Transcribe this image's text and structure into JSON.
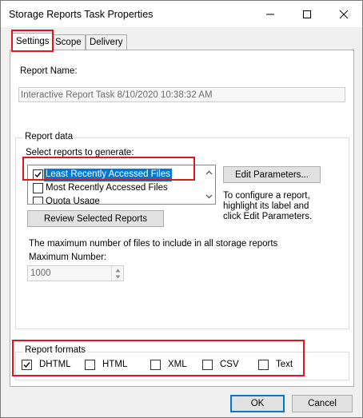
{
  "window": {
    "title": "Storage Reports Task Properties"
  },
  "tabs": [
    {
      "label": "Settings"
    },
    {
      "label": "Scope"
    },
    {
      "label": "Delivery"
    }
  ],
  "report_name": {
    "label": "Report Name:",
    "value": "Interactive Report Task 8/10/2020 10:38:32 AM"
  },
  "report_data": {
    "group_title": "Report data",
    "select_label": "Select reports to generate:",
    "items": [
      {
        "label": "Least Recently Accessed Files",
        "checked": true
      },
      {
        "label": "Most Recently Accessed Files",
        "checked": false
      },
      {
        "label": "Quota Usage",
        "checked": false
      }
    ],
    "edit_button": "Edit Parameters...",
    "help_lines": [
      "To configure a report,",
      "highlight its label and",
      "click Edit Parameters."
    ],
    "review_button": "Review Selected Reports",
    "max_desc": "The maximum number of files to include in all storage reports",
    "max_label": "Maximum Number:",
    "max_value": "1000"
  },
  "report_formats": {
    "group_title": "Report formats",
    "options": [
      {
        "label": "DHTML",
        "checked": true
      },
      {
        "label": "HTML",
        "checked": false
      },
      {
        "label": "XML",
        "checked": false
      },
      {
        "label": "CSV",
        "checked": false
      },
      {
        "label": "Text",
        "checked": false
      }
    ]
  },
  "footer": {
    "ok": "OK",
    "cancel": "Cancel"
  },
  "colors": {
    "highlight": "#e0161b",
    "selection": "#0078d7"
  }
}
